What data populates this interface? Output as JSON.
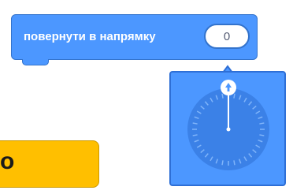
{
  "block": {
    "label": "повернути в напрямку",
    "direction_value": "0",
    "color": "#4C97FF",
    "border_color": "#3373CC"
  },
  "dial": {
    "direction_degrees": 0,
    "tick_count": 36,
    "handle_icon": "arrow-up-icon"
  },
  "partial_button": {
    "label": "o",
    "color": "#FFBF00"
  }
}
